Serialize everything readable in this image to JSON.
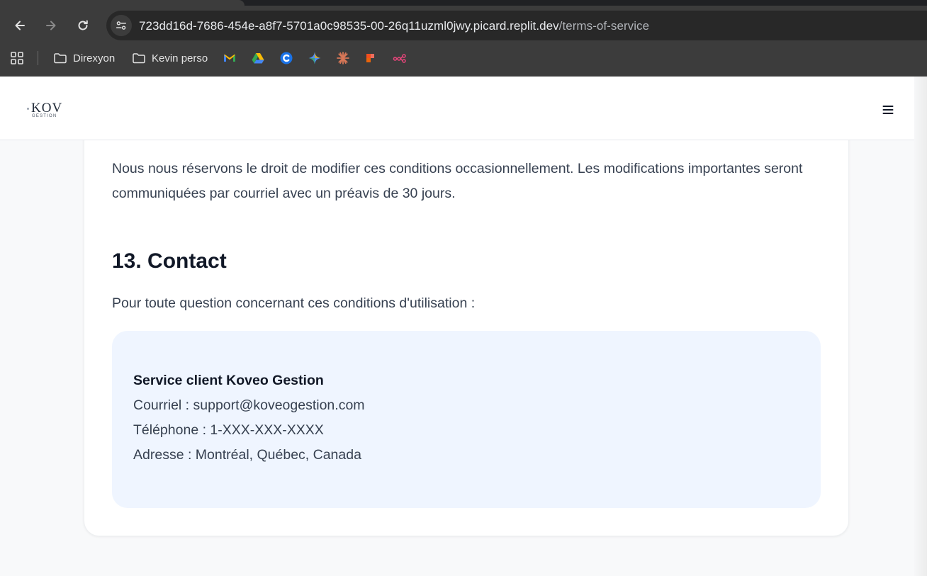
{
  "browser": {
    "url_host": "723dd16d-7686-454e-a8f7-5701a0c98535-00-26q11uzml0jwy.picard.replit.dev",
    "url_path": "/terms-of-service",
    "bookmarks": [
      {
        "label": "Direxyon",
        "icon": "folder-icon"
      },
      {
        "label": "Kevin perso",
        "icon": "folder-icon"
      },
      {
        "label": "",
        "icon": "gmail-icon"
      },
      {
        "label": "",
        "icon": "google-drive-icon"
      },
      {
        "label": "",
        "icon": "c-app-icon"
      },
      {
        "label": "",
        "icon": "gemini-icon"
      },
      {
        "label": "",
        "icon": "claude-icon"
      },
      {
        "label": "",
        "icon": "figma-icon"
      },
      {
        "label": "",
        "icon": "workflow-icon"
      }
    ]
  },
  "site": {
    "logo_main": "KOV",
    "logo_sub": "GESTION"
  },
  "content": {
    "intro_paragraph": "Nous nous réservons le droit de modifier ces conditions occasionnellement. Les modifications importantes seront communiquées par courriel avec un préavis de 30 jours.",
    "section_title": "13. Contact",
    "section_text": "Pour toute question concernant ces conditions d'utilisation :",
    "contact": {
      "title": "Service client Koveo Gestion",
      "email": "Courriel : support@koveogestion.com",
      "phone": "Téléphone : 1-XXX-XXX-XXXX",
      "address": "Adresse : Montréal, Québec, Canada"
    }
  },
  "colors": {
    "chrome_bg": "#3c3c3c",
    "omnibox_bg": "#282828",
    "page_bg": "#f8f9fa",
    "contact_bg": "#eff5ff",
    "heading": "#111827",
    "body_text": "#374151"
  }
}
